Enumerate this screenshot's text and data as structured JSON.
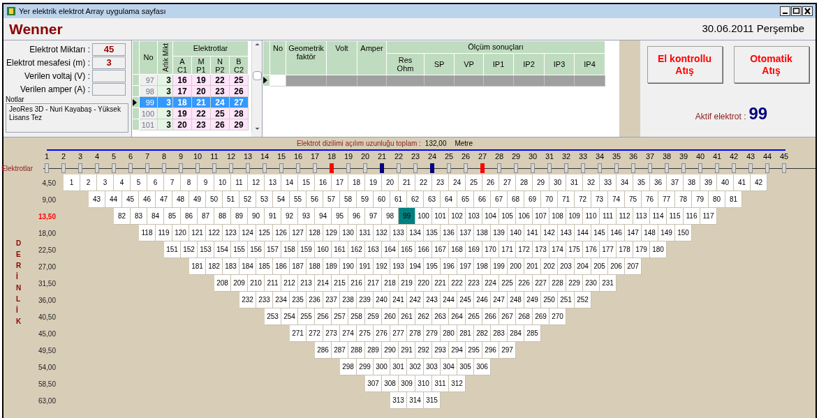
{
  "window": {
    "title": "Yer elektrik elektrot Array uygulama sayfası"
  },
  "header": {
    "array_type": "Wenner",
    "date": "30.06.2011 Perşembe"
  },
  "settings": [
    {
      "label": "Elektrot Miktarı :",
      "value": "45"
    },
    {
      "label": "Elektrot mesafesi (m) :",
      "value": "3"
    },
    {
      "label": "Verilen voltaj (V) :"
    },
    {
      "label": "Verilen amper (A) :"
    }
  ],
  "notes": {
    "label": "Notlar",
    "text": "JeoRes 3D - Nuri Kayabaş - Yüksek Lisans Tez"
  },
  "electrode_table": {
    "no_header": "No",
    "spacing_header": "Arlık Mikt",
    "group_header": "Elektrotlar",
    "electrode_headers": [
      [
        "A",
        "C1"
      ],
      [
        "M",
        "P1"
      ],
      [
        "N",
        "P2"
      ],
      [
        "B",
        "C2"
      ]
    ],
    "rows": [
      {
        "no": "97",
        "spacing": "3",
        "electrodes": [
          "16",
          "19",
          "22",
          "25"
        ],
        "selected": false
      },
      {
        "no": "98",
        "spacing": "3",
        "electrodes": [
          "17",
          "20",
          "23",
          "26"
        ],
        "selected": false
      },
      {
        "no": "99",
        "spacing": "3",
        "electrodes": [
          "18",
          "21",
          "24",
          "27"
        ],
        "selected": true
      },
      {
        "no": "100",
        "spacing": "3",
        "electrodes": [
          "19",
          "22",
          "25",
          "28"
        ],
        "selected": false
      },
      {
        "no": "101",
        "spacing": "3",
        "electrodes": [
          "20",
          "23",
          "26",
          "29"
        ],
        "selected": false
      }
    ]
  },
  "results_table": {
    "columns": [
      "No",
      "Geometrik faktör",
      "Volt",
      "Amper"
    ],
    "group_header": "Ölçüm sonuçları",
    "result_columns": [
      "Res Ohm",
      "SP",
      "VP",
      "IP1",
      "IP2",
      "IP3",
      "IP4"
    ]
  },
  "buttons": [
    "El kontrollu Atış",
    "Otomatik Atış"
  ],
  "active_electrode": {
    "label": "Aktif elektrot :",
    "value": "99"
  },
  "spread": {
    "label": "Elektrot dizilimi açılım uzunluğu toplam :",
    "value": "132,00",
    "unit": "Metre"
  },
  "electrodes_label": "Elektrotlar",
  "electrodes": [
    {
      "label": "1",
      "kind": "idle"
    },
    {
      "label": "2",
      "kind": "idle"
    },
    {
      "label": "3",
      "kind": "idle"
    },
    {
      "label": "4",
      "kind": "idle"
    },
    {
      "label": "5",
      "kind": "idle"
    },
    {
      "label": "6",
      "kind": "idle"
    },
    {
      "label": "7",
      "kind": "idle"
    },
    {
      "label": "8",
      "kind": "idle"
    },
    {
      "label": "9",
      "kind": "idle"
    },
    {
      "label": "10",
      "kind": "idle"
    },
    {
      "label": "11",
      "kind": "idle"
    },
    {
      "label": "12",
      "kind": "idle"
    },
    {
      "label": "13",
      "kind": "idle"
    },
    {
      "label": "14",
      "kind": "idle"
    },
    {
      "label": "15",
      "kind": "idle"
    },
    {
      "label": "16",
      "kind": "idle"
    },
    {
      "label": "17",
      "kind": "idle"
    },
    {
      "label": "18",
      "kind": "current"
    },
    {
      "label": "19",
      "kind": "idle"
    },
    {
      "label": "20",
      "kind": "idle"
    },
    {
      "label": "21",
      "kind": "potential"
    },
    {
      "label": "22",
      "kind": "idle"
    },
    {
      "label": "23",
      "kind": "idle"
    },
    {
      "label": "24",
      "kind": "potential"
    },
    {
      "label": "25",
      "kind": "idle"
    },
    {
      "label": "26",
      "kind": "idle"
    },
    {
      "label": "27",
      "kind": "current"
    },
    {
      "label": "28",
      "kind": "idle"
    },
    {
      "label": "29",
      "kind": "idle"
    },
    {
      "label": "30",
      "kind": "idle"
    },
    {
      "label": "31",
      "kind": "idle"
    },
    {
      "label": "32",
      "kind": "idle"
    },
    {
      "label": "33",
      "kind": "idle"
    },
    {
      "label": "34",
      "kind": "idle"
    },
    {
      "label": "35",
      "kind": "idle"
    },
    {
      "label": "36",
      "kind": "idle"
    },
    {
      "label": "37",
      "kind": "idle"
    },
    {
      "label": "38",
      "kind": "idle"
    },
    {
      "label": "39",
      "kind": "idle"
    },
    {
      "label": "40",
      "kind": "idle"
    },
    {
      "label": "41",
      "kind": "idle"
    },
    {
      "label": "42",
      "kind": "idle"
    },
    {
      "label": "43",
      "kind": "idle"
    },
    {
      "label": "44",
      "kind": "idle"
    },
    {
      "label": "45",
      "kind": "idle"
    }
  ],
  "depth_axis_label": "DERİNLİK",
  "pseudosection": {
    "rows": [
      {
        "depth": "4,50",
        "selected": false,
        "cells": [
          "1",
          "2",
          "3",
          "4",
          "5",
          "6",
          "7",
          "8",
          "9",
          "10",
          "11",
          "12",
          "13",
          "14",
          "15",
          "16",
          "17",
          "18",
          "19",
          "20",
          "21",
          "22",
          "23",
          "24",
          "25",
          "26",
          "27",
          "28",
          "29",
          "30",
          "31",
          "32",
          "33",
          "34",
          "35",
          "36",
          "37",
          "38",
          "39",
          "40",
          "41",
          "42"
        ]
      },
      {
        "depth": "9,00",
        "selected": false,
        "cells": [
          "43",
          "44",
          "45",
          "46",
          "47",
          "48",
          "49",
          "50",
          "51",
          "52",
          "53",
          "54",
          "55",
          "56",
          "57",
          "58",
          "59",
          "60",
          "61",
          "62",
          "63",
          "64",
          "65",
          "66",
          "67",
          "68",
          "69",
          "70",
          "71",
          "72",
          "73",
          "74",
          "75",
          "76",
          "77",
          "78",
          "79",
          "80",
          "81"
        ]
      },
      {
        "depth": "13,50",
        "selected": true,
        "cells": [
          "82",
          "83",
          "84",
          "85",
          "86",
          "87",
          "88",
          "89",
          "90",
          "91",
          "92",
          "93",
          "94",
          "95",
          "96",
          "97",
          "98",
          {
            "text": "99",
            "selected": true
          },
          "100",
          "101",
          "102",
          "103",
          "104",
          "105",
          "106",
          "107",
          "108",
          "109",
          "110",
          "111",
          "112",
          "113",
          "114",
          "115",
          "116",
          "117"
        ]
      },
      {
        "depth": "18,00",
        "selected": false,
        "cells": [
          "118",
          "119",
          "120",
          "121",
          "122",
          "123",
          "124",
          "125",
          "126",
          "127",
          "128",
          "129",
          "130",
          "131",
          "132",
          "133",
          "134",
          "135",
          "136",
          "137",
          "138",
          "139",
          "140",
          "141",
          "142",
          "143",
          "144",
          "145",
          "146",
          "147",
          "148",
          "149",
          "150"
        ]
      },
      {
        "depth": "22,50",
        "selected": false,
        "cells": [
          "151",
          "152",
          "153",
          "154",
          "155",
          "156",
          "157",
          "158",
          "159",
          "160",
          "161",
          "162",
          "163",
          "164",
          "165",
          "166",
          "167",
          "168",
          "169",
          "170",
          "171",
          "172",
          "173",
          "174",
          "175",
          "176",
          "177",
          "178",
          "179",
          "180"
        ]
      },
      {
        "depth": "27,00",
        "selected": false,
        "cells": [
          "181",
          "182",
          "183",
          "184",
          "185",
          "186",
          "187",
          "188",
          "189",
          "190",
          "191",
          "192",
          "193",
          "194",
          "195",
          "196",
          "197",
          "198",
          "199",
          "200",
          "201",
          "202",
          "203",
          "204",
          "205",
          "206",
          "207"
        ]
      },
      {
        "depth": "31,50",
        "selected": false,
        "cells": [
          "208",
          "209",
          "210",
          "211",
          "212",
          "213",
          "214",
          "215",
          "216",
          "217",
          "218",
          "219",
          "220",
          "221",
          "222",
          "223",
          "224",
          "225",
          "226",
          "227",
          "228",
          "229",
          "230",
          "231"
        ]
      },
      {
        "depth": "36,00",
        "selected": false,
        "cells": [
          "232",
          "233",
          "234",
          "235",
          "236",
          "237",
          "238",
          "239",
          "240",
          "241",
          "242",
          "243",
          "244",
          "245",
          "246",
          "247",
          "248",
          "249",
          "250",
          "251",
          "252"
        ]
      },
      {
        "depth": "40,50",
        "selected": false,
        "cells": [
          "253",
          "254",
          "255",
          "256",
          "257",
          "258",
          "259",
          "260",
          "261",
          "262",
          "263",
          "264",
          "265",
          "266",
          "267",
          "268",
          "269",
          "270"
        ]
      },
      {
        "depth": "45,00",
        "selected": false,
        "cells": [
          "271",
          "272",
          "273",
          "274",
          "275",
          "276",
          "277",
          "278",
          "279",
          "280",
          "281",
          "282",
          "283",
          "284",
          "285"
        ]
      },
      {
        "depth": "49,50",
        "selected": false,
        "cells": [
          "286",
          "287",
          "288",
          "289",
          "290",
          "291",
          "292",
          "293",
          "294",
          "295",
          "296",
          "297"
        ]
      },
      {
        "depth": "54,00",
        "selected": false,
        "cells": [
          "298",
          "299",
          "300",
          "301",
          "302",
          "303",
          "304",
          "305",
          "306"
        ]
      },
      {
        "depth": "58,50",
        "selected": false,
        "cells": [
          "307",
          "308",
          "309",
          "310",
          "311",
          "312"
        ]
      },
      {
        "depth": "63,00",
        "selected": false,
        "cells": [
          "313",
          "314",
          "315"
        ]
      }
    ]
  }
}
